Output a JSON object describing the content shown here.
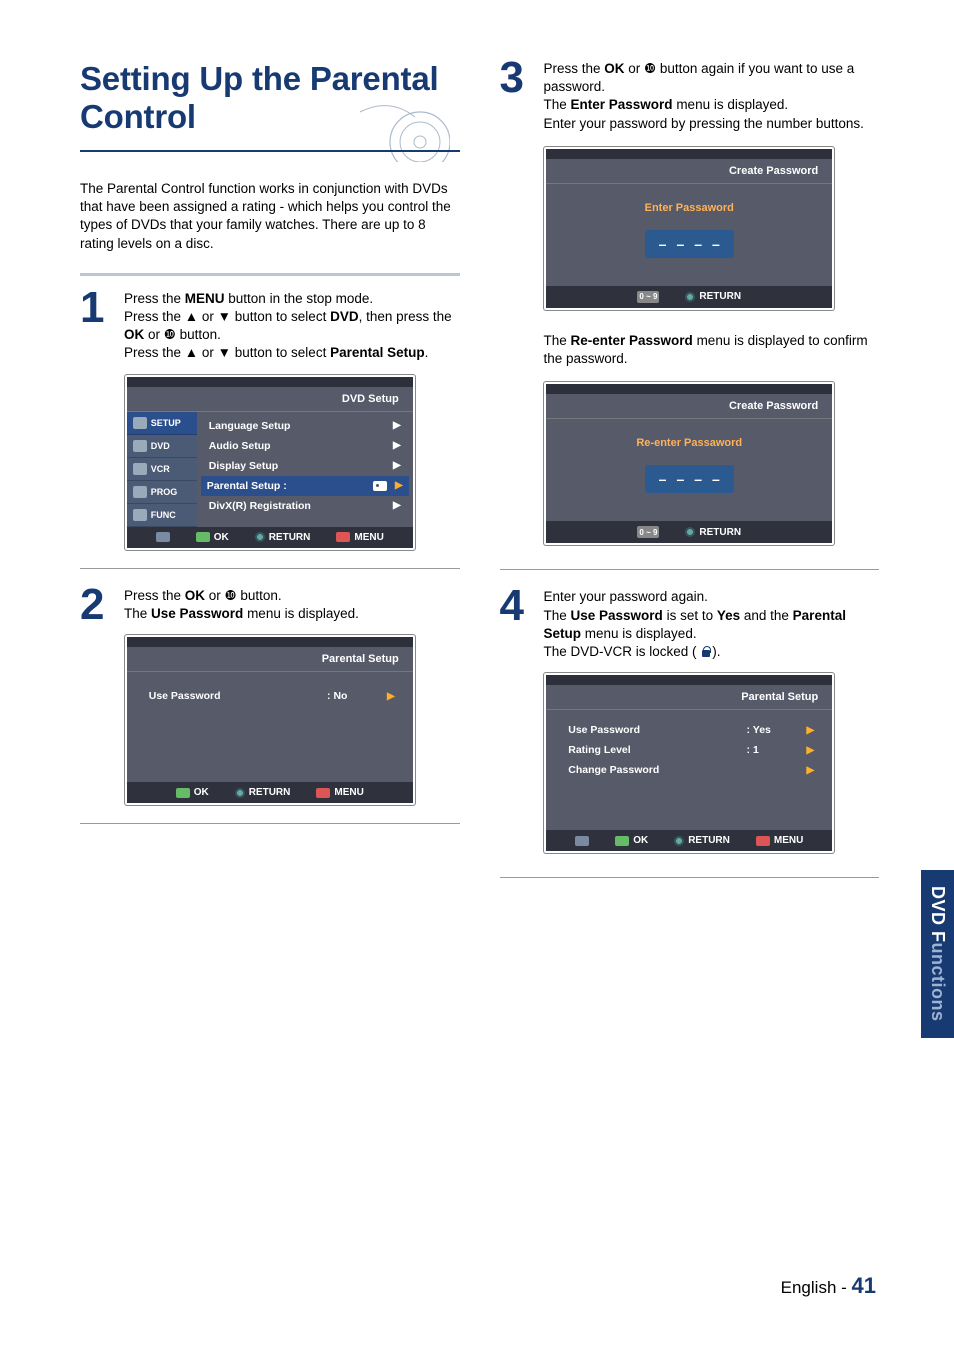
{
  "title": "Setting Up the Parental Control",
  "intro": "The Parental Control function works in conjunction with DVDs that have been assigned a rating - which helps you control the types of DVDs that your family watches. There are up to 8 rating levels on a disc.",
  "steps": {
    "s1": {
      "num": "1",
      "line1a": "Press the ",
      "line1b": "MENU",
      "line1c": " button in the stop mode.",
      "line2a": "Press the ▲ or ▼ button to select ",
      "line2b": "DVD",
      "line2c": ", then press the ",
      "line2d": "OK",
      "line2e": " or ❿ button.",
      "line3a": "Press the ▲ or ▼ button to select ",
      "line3b": "Parental Setup",
      "line3c": "."
    },
    "s2": {
      "num": "2",
      "line1a": "Press the ",
      "line1b": "OK",
      "line1c": " or ❿ button.",
      "line2a": "The ",
      "line2b": "Use Password",
      "line2c": " menu is displayed."
    },
    "s3": {
      "num": "3",
      "line1a": "Press  the ",
      "line1b": "OK",
      "line1c": " or ❿ button again if you want to use a password.",
      "line2a": "The ",
      "line2b": "Enter Password",
      "line2c": " menu is displayed.",
      "line3": "Enter your password by pressing the number buttons.",
      "after1a": "The ",
      "after1b": "Re-enter Password",
      "after1c": " menu is displayed to confirm the password."
    },
    "s4": {
      "num": "4",
      "line1": "Enter your password again.",
      "line2a": "The ",
      "line2b": "Use Password",
      "line2c": " is set to ",
      "line2d": "Yes",
      "line2e": " and the ",
      "line2f": "Parental Setup",
      "line2g": " menu is displayed.",
      "line3a": "The DVD-VCR is locked (   ",
      "line3b": ")."
    }
  },
  "osd": {
    "dvd_setup": {
      "title": "DVD  Setup",
      "tabs": [
        "SETUP",
        "DVD",
        "VCR",
        "PROG",
        "FUNC"
      ],
      "rows": [
        {
          "label": "Language Setup"
        },
        {
          "label": "Audio Setup"
        },
        {
          "label": "Display Setup"
        },
        {
          "label": "Parental Setup :",
          "hl": true,
          "key": true
        },
        {
          "label": "DivX(R) Registration"
        }
      ],
      "footer": [
        "OK",
        "RETURN",
        "MENU"
      ]
    },
    "parental_no": {
      "title": "Parental Setup",
      "rows": [
        {
          "label": "Use Password",
          "val": ": No"
        }
      ],
      "footer": [
        "OK",
        "RETURN",
        "MENU"
      ]
    },
    "create_pw": {
      "title": "Create Password",
      "label": "Enter Passaword",
      "slots": [
        "–",
        "–",
        "–",
        "–"
      ],
      "footer_num": "0 ~ 9",
      "footer": [
        "RETURN"
      ]
    },
    "reenter_pw": {
      "title": "Create Password",
      "label": "Re-enter Passaword",
      "slots": [
        "–",
        "–",
        "–",
        "–"
      ],
      "footer_num": "0 ~ 9",
      "footer": [
        "RETURN"
      ]
    },
    "parental_yes": {
      "title": "Parental Setup",
      "rows": [
        {
          "label": "Use Password",
          "val": ": Yes"
        },
        {
          "label": "Rating Level",
          "val": ": 1"
        },
        {
          "label": "Change Password",
          "val": ""
        }
      ],
      "footer": [
        "OK",
        "RETURN",
        "MENU"
      ]
    }
  },
  "side_tab": {
    "a": "DVD F",
    "b": "unctions"
  },
  "footer": {
    "lang": "English",
    "sep": " - ",
    "page": "41"
  }
}
